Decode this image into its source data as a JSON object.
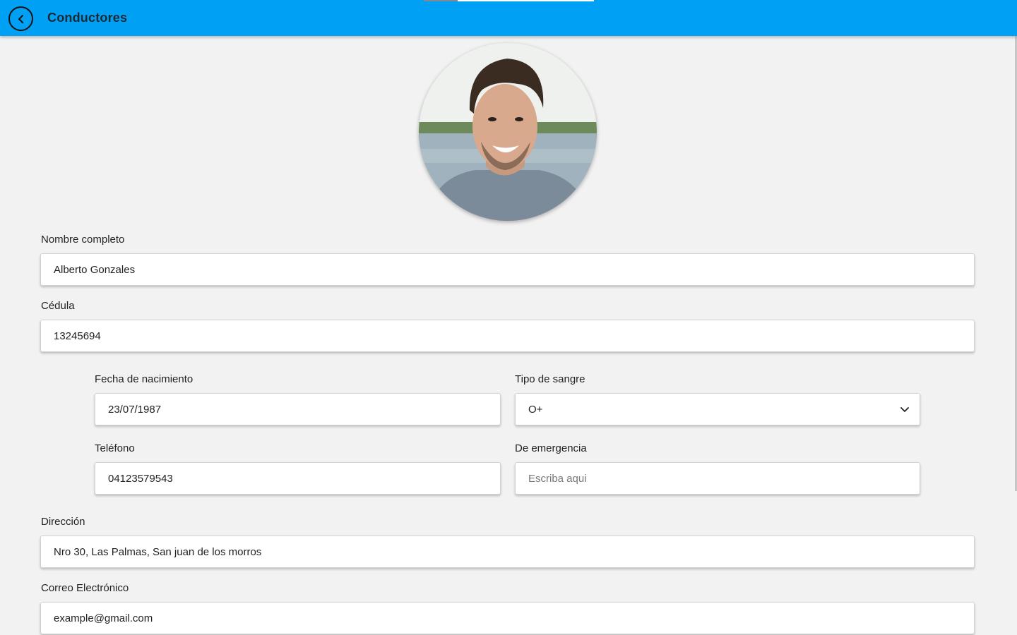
{
  "header": {
    "title": "Conductores",
    "back_icon": "chevron-left-circle-icon",
    "color": "#00a0f5"
  },
  "profile": {
    "photo": "driver-profile-photo"
  },
  "form": {
    "full_name": {
      "label": "Nombre completo",
      "value": "Alberto Gonzales"
    },
    "id_number": {
      "label": "Cédula",
      "value": "13245694"
    },
    "birth_date": {
      "label": "Fecha de nacimiento",
      "value": "23/07/1987"
    },
    "blood_type": {
      "label": "Tipo de sangre",
      "value": "O+",
      "icon": "chevron-down-icon"
    },
    "phone": {
      "label": "Teléfono",
      "value": "04123579543"
    },
    "emergency": {
      "label": "De emergencia",
      "value": "",
      "placeholder": "Escriba aqui"
    },
    "address": {
      "label": "Dirección",
      "value": "Nro 30, Las Palmas, San juan de los morros"
    },
    "email": {
      "label": "Correo Electrónico",
      "value": "example@gmail.com"
    }
  }
}
